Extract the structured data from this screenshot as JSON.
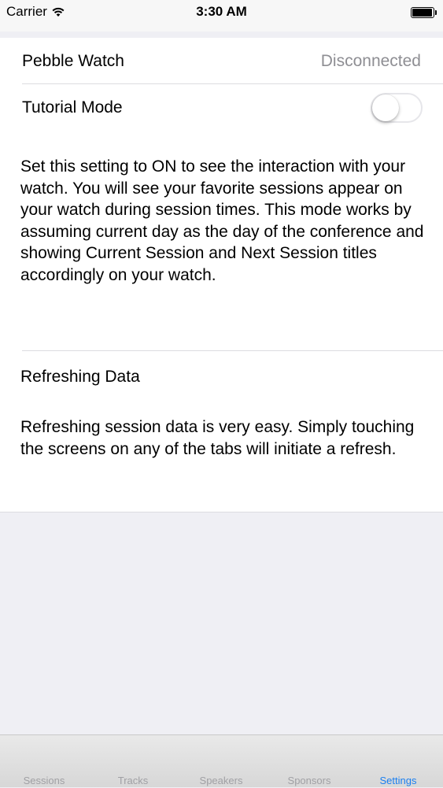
{
  "status_bar": {
    "carrier": "Carrier",
    "time": "3:30 AM"
  },
  "settings": {
    "pebble_watch": {
      "label": "Pebble Watch",
      "value": "Disconnected"
    },
    "tutorial_mode": {
      "label": "Tutorial Mode",
      "enabled": false
    },
    "tutorial_description": "Set this setting to ON to see the interaction with your watch. You will see your favorite sessions appear on your watch during session times. This mode works by assuming current day as the day of the conference and showing Current Session and Next Session titles accordingly on your watch.",
    "refreshing_title": "Refreshing Data",
    "refreshing_description": "Refreshing session data is very easy. Simply touching the screens on any of the tabs will initiate a refresh."
  },
  "tab_bar": {
    "tabs": [
      {
        "label": "Sessions"
      },
      {
        "label": "Tracks"
      },
      {
        "label": "Speakers"
      },
      {
        "label": "Sponsors"
      },
      {
        "label": "Settings",
        "active": true
      }
    ],
    "active_color": "#1a7ff0",
    "inactive_color": "#a0a0a4"
  }
}
